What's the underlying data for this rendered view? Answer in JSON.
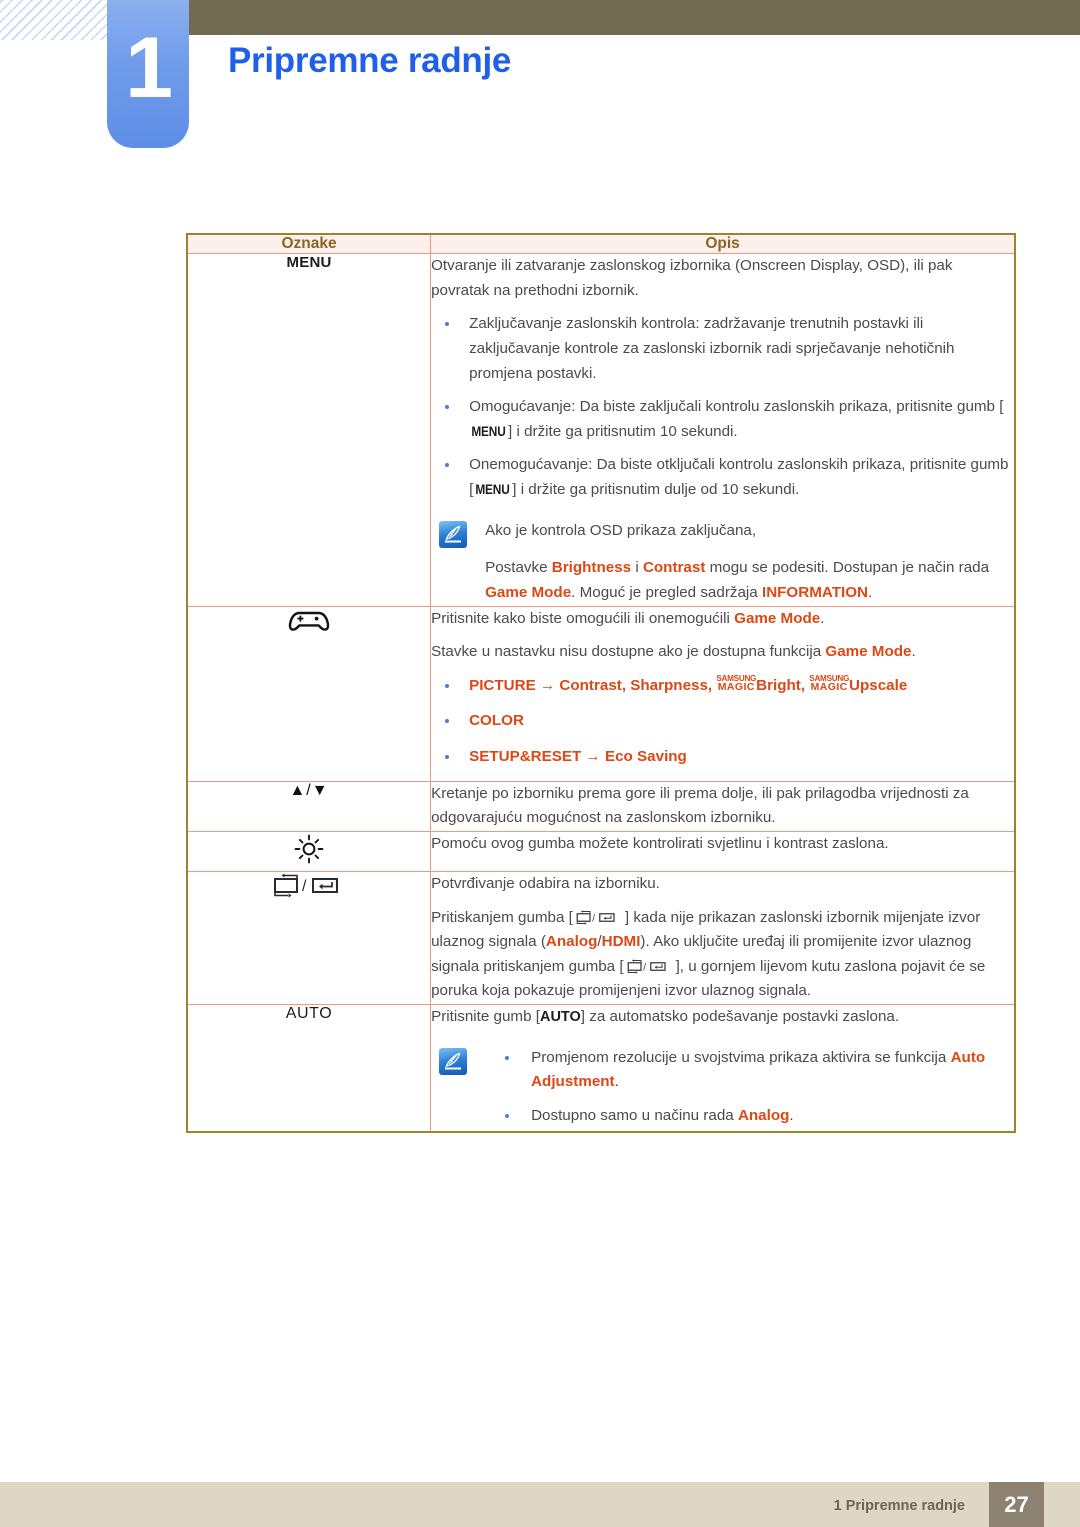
{
  "header": {
    "chapter_number": "1",
    "title": "Pripremne radnje",
    "accent_blue": "#2060e8",
    "tab_blue": "#6f9bea",
    "olive": "#706b52"
  },
  "table": {
    "columns": [
      "Oznake",
      "Opis"
    ],
    "rows": [
      {
        "id": "menu",
        "icon_type": "text-label",
        "icon_label": "MENU",
        "blocks": [
          {
            "type": "para",
            "runs": [
              {
                "t": "Otvaranje ili zatvaranje zaslonskog izbornika (Onscreen Display, OSD), ili pak povratak na prethodni izbornik."
              }
            ]
          },
          {
            "type": "bullets",
            "items": [
              {
                "runs": [
                  {
                    "t": "Zaključavanje zaslonskih kontrola: zadržavanje trenutnih postavki ili zaključavanje kontrole za zaslonski izbornik radi sprječavanje nehotičnih promjena postavki."
                  }
                ]
              },
              {
                "runs": [
                  {
                    "t": "Omogućavanje: Da biste zaključali kontrolu zaslonskih prikaza, pritisnite gumb ["
                  },
                  {
                    "t": "MENU",
                    "style": "key"
                  },
                  {
                    "t": "] i držite ga pritisnutim 10 sekundi."
                  }
                ]
              },
              {
                "runs": [
                  {
                    "t": "Onemogućavanje: Da biste otključali kontrolu zaslonskih prikaza, pritisnite gumb ["
                  },
                  {
                    "t": "MENU",
                    "style": "key"
                  },
                  {
                    "t": "] i držite ga pritisnutim dulje od 10 sekundi."
                  }
                ]
              }
            ]
          },
          {
            "type": "note",
            "icon": "note-pen-icon",
            "paras": [
              {
                "runs": [
                  {
                    "t": "Ako je kontrola OSD prikaza zaključana,"
                  }
                ]
              },
              {
                "runs": [
                  {
                    "t": "Postavke "
                  },
                  {
                    "t": "Brightness",
                    "style": "orange"
                  },
                  {
                    "t": " i "
                  },
                  {
                    "t": "Contrast",
                    "style": "orange"
                  },
                  {
                    "t": " mogu se podesiti. Dostupan je način rada "
                  },
                  {
                    "t": "Game Mode",
                    "style": "orange"
                  },
                  {
                    "t": ". Moguć je pregled sadržaja "
                  },
                  {
                    "t": "INFORMATION",
                    "style": "orange"
                  },
                  {
                    "t": "."
                  }
                ]
              }
            ]
          }
        ]
      },
      {
        "id": "game-mode",
        "icon_type": "gamepad",
        "icon_label": "gamepad-icon",
        "blocks": [
          {
            "type": "para",
            "runs": [
              {
                "t": "Pritisnite kako biste omogućili ili onemogućili "
              },
              {
                "t": "Game Mode",
                "style": "orange"
              },
              {
                "t": "."
              }
            ]
          },
          {
            "type": "para",
            "runs": [
              {
                "t": "Stavke u nastavku nisu dostupne ako je dostupna funkcija "
              },
              {
                "t": "Game Mode",
                "style": "orange"
              },
              {
                "t": "."
              }
            ]
          },
          {
            "type": "bullets-orange",
            "items": [
              {
                "runs": [
                  {
                    "t": "PICTURE",
                    "style": "orange"
                  },
                  {
                    "t": "  →  ",
                    "style": "orange"
                  },
                  {
                    "t": "Contrast, Sharpness, ",
                    "style": "orange"
                  },
                  {
                    "t": "MAGIC_SAMSUNG",
                    "style": "magic"
                  },
                  {
                    "t": "Bright, ",
                    "style": "orange"
                  },
                  {
                    "t": "MAGIC_SAMSUNG",
                    "style": "magic"
                  },
                  {
                    "t": "Upscale",
                    "style": "orange"
                  }
                ]
              },
              {
                "runs": [
                  {
                    "t": "COLOR",
                    "style": "orange"
                  }
                ]
              },
              {
                "runs": [
                  {
                    "t": "SETUP&RESET",
                    "style": "orange"
                  },
                  {
                    "t": "  →  ",
                    "style": "orange"
                  },
                  {
                    "t": "Eco Saving",
                    "style": "orange"
                  }
                ]
              }
            ]
          }
        ]
      },
      {
        "id": "up-down",
        "icon_type": "arrows",
        "icon_label": "▲/▼",
        "blocks": [
          {
            "type": "para",
            "runs": [
              {
                "t": "Kretanje po izborniku prema gore ili prema dolje, ili pak prilagodba vrijednosti za odgovarajuću mogućnost na zaslonskom izborniku."
              }
            ]
          }
        ]
      },
      {
        "id": "brightness",
        "icon_type": "sun",
        "icon_label": "brightness-sun-icon",
        "blocks": [
          {
            "type": "para",
            "runs": [
              {
                "t": "Pomoću ovog gumba možete kontrolirati svjetlinu i kontrast zaslona."
              }
            ]
          }
        ]
      },
      {
        "id": "source-enter",
        "icon_type": "source-enter",
        "icon_label": "source-enter-icon",
        "blocks": [
          {
            "type": "para",
            "runs": [
              {
                "t": "Potvrđivanje odabira na izborniku."
              }
            ]
          },
          {
            "type": "para",
            "runs": [
              {
                "t": "Pritiskanjem gumba ["
              },
              {
                "t": "SOURCE_ENTER",
                "style": "glyph"
              },
              {
                "t": "] kada nije prikazan zaslonski izbornik mijenjate izvor ulaznog signala ("
              },
              {
                "t": "Analog",
                "style": "orange"
              },
              {
                "t": "/"
              },
              {
                "t": "HDMI",
                "style": "orange"
              },
              {
                "t": "). Ako uključite uređaj ili promijenite izvor ulaznog signala pritiskanjem gumba ["
              },
              {
                "t": "SOURCE_ENTER",
                "style": "glyph"
              },
              {
                "t": "], u gornjem lijevom kutu zaslona pojavit će se poruka koja pokazuje promijenjeni izvor ulaznog signala."
              }
            ]
          }
        ]
      },
      {
        "id": "auto",
        "icon_type": "text-label-thin",
        "icon_label": "AUTO",
        "blocks": [
          {
            "type": "para",
            "runs": [
              {
                "t": "Pritisnite gumb ["
              },
              {
                "t": "AUTO",
                "style": "key-auto"
              },
              {
                "t": "] za automatsko podešavanje postavki zaslona."
              }
            ]
          },
          {
            "type": "note-bullets",
            "icon": "note-pen-icon",
            "items": [
              {
                "runs": [
                  {
                    "t": "Promjenom rezolucije u svojstvima prikaza aktivira se funkcija "
                  },
                  {
                    "t": "Auto Adjustment",
                    "style": "orange"
                  },
                  {
                    "t": "."
                  }
                ]
              },
              {
                "runs": [
                  {
                    "t": "Dostupno samo u načinu rada "
                  },
                  {
                    "t": "Analog",
                    "style": "orange"
                  },
                  {
                    "t": "."
                  }
                ]
              }
            ]
          }
        ]
      }
    ]
  },
  "footer": {
    "text": "1 Pripremne radnje",
    "page_number": "27",
    "bar_color": "#ded7c5",
    "page_box_color": "#8d8271"
  },
  "colors": {
    "orange_accent": "#dd4814",
    "table_border": "#9b8430",
    "inner_border": "#ee9a83",
    "header_bg": "#fcefec",
    "header_text": "#8a6620"
  }
}
